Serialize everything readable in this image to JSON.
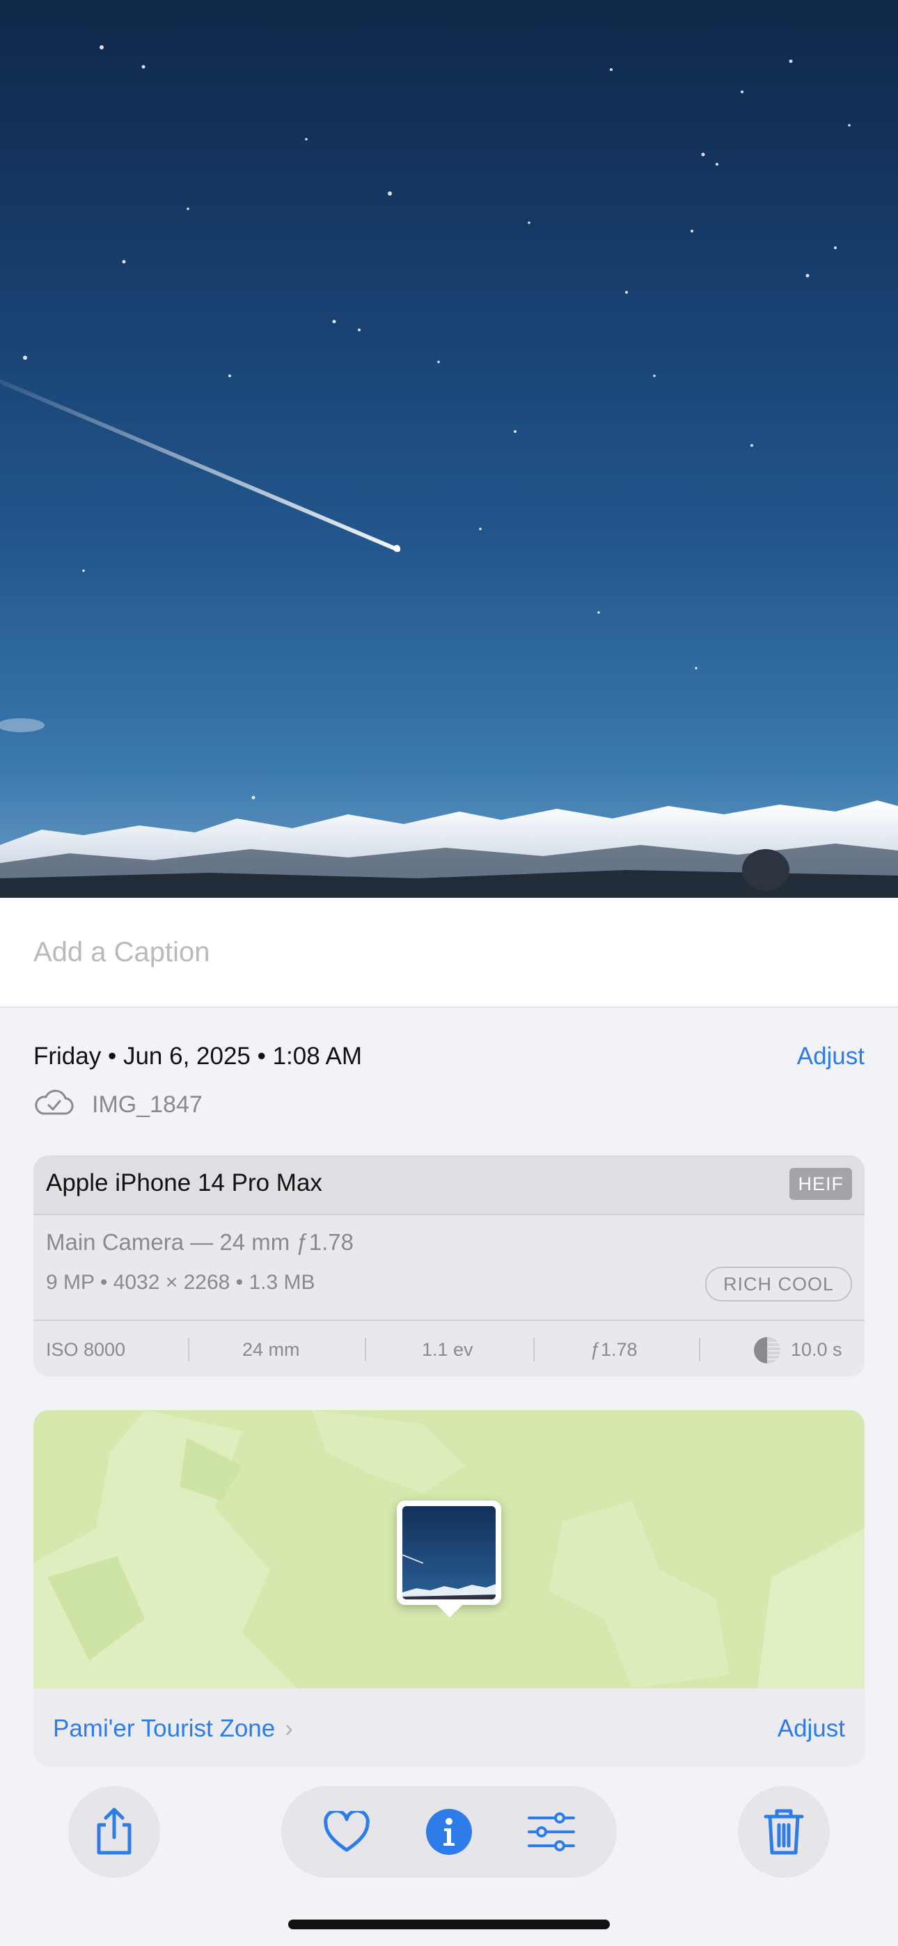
{
  "caption": {
    "placeholder": "Add a Caption"
  },
  "info": {
    "date": "Friday • Jun 6, 2025 • 1:08 AM",
    "adjust_label": "Adjust",
    "filename": "IMG_1847",
    "cloud_icon": "icloud-checkmark-icon"
  },
  "exif": {
    "device": "Apple iPhone 14 Pro Max",
    "format_badge": "HEIF",
    "lens": "Main Camera — 24 mm ƒ1.78",
    "specs": "9 MP  •  4032 × 2268  •  1.3 MB",
    "style_badge": "RICH COOL",
    "iso": "ISO 8000",
    "focal": "24 mm",
    "exposure": "1.1 ev",
    "aperture": "ƒ1.78",
    "shutter": "10.0 s"
  },
  "map": {
    "location": "Pami'er Tourist Zone",
    "chevron": "›",
    "adjust_label": "Adjust"
  },
  "toolbar": {
    "share_icon": "share-icon",
    "favorite_icon": "heart-icon",
    "info_icon": "info-icon",
    "edit_icon": "sliders-icon",
    "delete_icon": "trash-icon"
  },
  "colors": {
    "accent": "#2e7ce8",
    "map_green": "#d5e9ae"
  }
}
